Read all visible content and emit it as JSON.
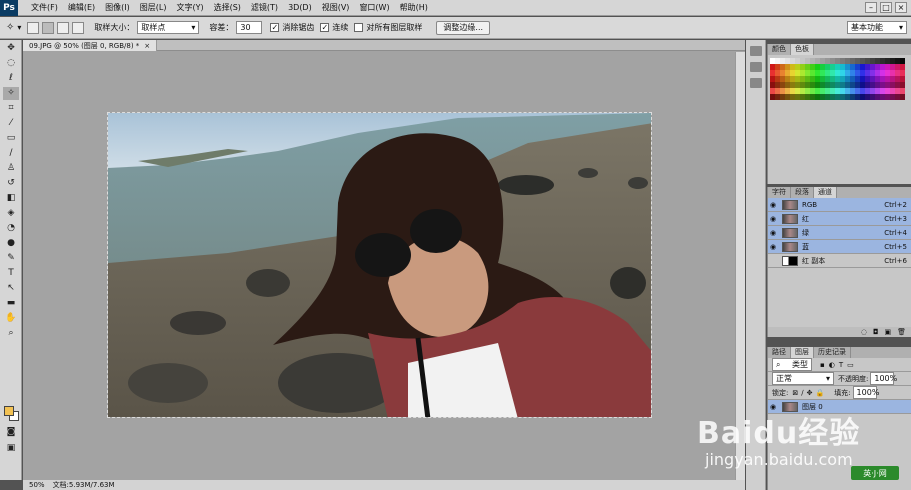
{
  "app": {
    "logo": "Ps"
  },
  "menu": [
    "文件(F)",
    "编辑(E)",
    "图像(I)",
    "图层(L)",
    "文字(Y)",
    "选择(S)",
    "滤镜(T)",
    "3D(D)",
    "视图(V)",
    "窗口(W)",
    "帮助(H)"
  ],
  "workspace": "基本功能",
  "options": {
    "sample_size_label": "取样大小：",
    "sample_size_value": "取样点",
    "tolerance_label": "容差：",
    "tolerance_value": "30",
    "antialias_label": "消除锯齿",
    "contiguous_label": "连续",
    "sample_all_label": "对所有图层取样",
    "refine_edge_button": "调整边缘..."
  },
  "document": {
    "tab_title": "09.JPG @ 50% (图层 0, RGB/8) *",
    "tab_close": "×"
  },
  "status": {
    "zoom": "50%",
    "doc_size": "文档:5.93M/7.63M"
  },
  "swatches_panel": {
    "tabs": [
      "颜色",
      "色板"
    ]
  },
  "channels_panel": {
    "tabs": [
      "字符",
      "段落",
      "通道"
    ],
    "rows": [
      {
        "name": "RGB",
        "shortcut": "Ctrl+2",
        "selected": true,
        "visible": true
      },
      {
        "name": "红",
        "shortcut": "Ctrl+3",
        "selected": true,
        "visible": true
      },
      {
        "name": "绿",
        "shortcut": "Ctrl+4",
        "selected": true,
        "visible": true
      },
      {
        "name": "蓝",
        "shortcut": "Ctrl+5",
        "selected": true,
        "visible": true
      },
      {
        "name": "红 副本",
        "shortcut": "Ctrl+6",
        "selected": false,
        "visible": false
      }
    ]
  },
  "layers_panel": {
    "tabs": [
      "路径",
      "图层",
      "历史记录"
    ],
    "filter": "类型",
    "blend_mode": "正常",
    "opacity_label": "不透明度:",
    "opacity_value": "100%",
    "lock_label": "锁定:",
    "fill_label": "填充:",
    "fill_value": "100%",
    "layer_name": "图层 0"
  },
  "watermark": {
    "text": "Baidu经验",
    "url": "jingyan.baidu.com",
    "badge": "英·J·网"
  },
  "colors": {
    "accent": "#9bb5e0",
    "foreground": "#f3c253"
  }
}
